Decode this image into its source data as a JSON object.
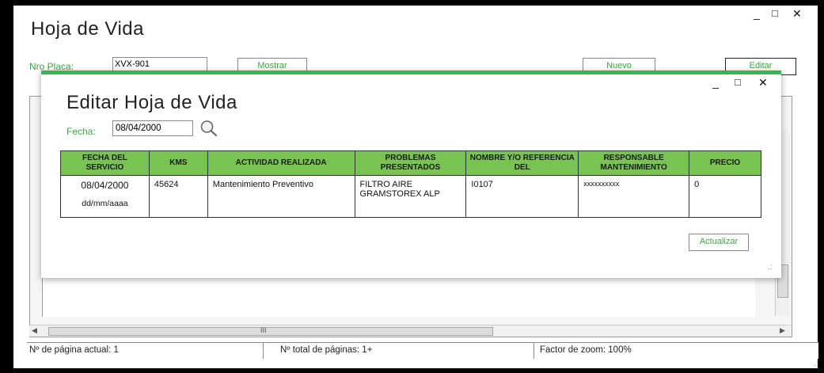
{
  "main_window": {
    "title": "Hoja de Vida",
    "controls": {
      "minimize": "_",
      "maximize": "□",
      "close": "✕"
    },
    "plate_label": "Nro Placa:",
    "plate_value": "XVX-901",
    "show_button": "Mostrar",
    "new_button": "Nuevo",
    "edit_button": "Editar"
  },
  "viewer": {
    "hscroll_marker": "III",
    "status": {
      "current_page": "Nº de página actual: 1",
      "total_pages": "Nº total de páginas: 1+",
      "zoom": "Factor de zoom: 100%"
    }
  },
  "dialog": {
    "title": "Editar Hoja de Vida",
    "controls": {
      "minimize": "_",
      "maximize": "□",
      "close": "✕"
    },
    "date_label": "Fecha:",
    "date_value": "08/04/2000",
    "search_icon": "magnifier-icon",
    "columns": [
      "FECHA DEL SERVICIO",
      "KMS",
      "ACTIVIDAD REALIZADA",
      "PROBLEMAS PRESENTADOS",
      "NOMBRE Y/O REFERENCIA DEL",
      "RESPONSABLE MANTENIMIENTO",
      "PRECIO"
    ],
    "row": {
      "date": "08/04/2000",
      "date_format": "dd/mm/aaaa",
      "kms": "45624",
      "activity": "Mantenimiento Preventivo",
      "problems": "FILTRO AIRE GRAMSTOREX ALP",
      "reference": "I0107",
      "responsible": "xxxxxxxxxx",
      "price": "0"
    },
    "update_button": "Actualizar"
  },
  "colors": {
    "accent_green": "#2fbb54",
    "header_green": "#79c254",
    "label_green": "#3aa73f"
  }
}
